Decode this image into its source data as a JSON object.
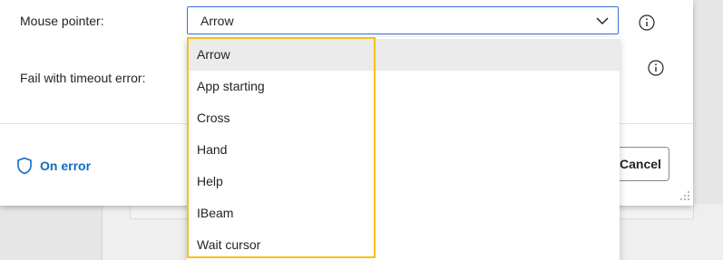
{
  "form": {
    "mouse_pointer_label": "Mouse pointer:",
    "fail_timeout_label": "Fail with timeout error:",
    "mouse_pointer_value": "Arrow"
  },
  "footer": {
    "on_error_label": "On error",
    "cancel_label": "Cancel"
  },
  "dropdown": {
    "options": [
      "Arrow",
      "App starting",
      "Cross",
      "Hand",
      "Help",
      "IBeam",
      "Wait cursor"
    ],
    "selected": "Arrow"
  },
  "colors": {
    "accent": "#0f6cbd",
    "focus_border": "#3b6fd4",
    "highlight": "#f2c21a"
  },
  "icons": [
    "chevron-down-icon",
    "info-icon",
    "shield-icon",
    "resize-grip-icon"
  ]
}
